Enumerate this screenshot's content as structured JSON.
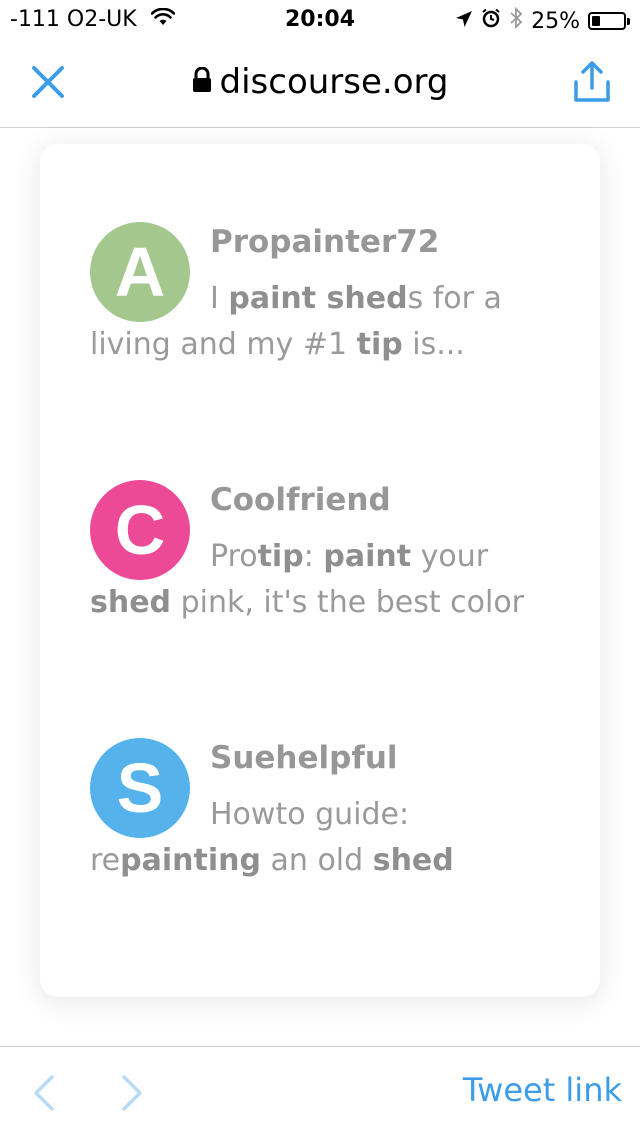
{
  "status_bar": {
    "carrier": "-111 O2-UK",
    "time": "20:04",
    "battery_percent": "25%",
    "battery_level": 0.25
  },
  "nav": {
    "domain": "discourse.org"
  },
  "results": [
    {
      "avatar_letter": "A",
      "avatar_color": "#a3c78d",
      "username": "Propainter72",
      "title_parts": [
        {
          "t": "I ",
          "b": false
        },
        {
          "t": "paint shed",
          "b": true
        },
        {
          "t": "s for a living and my #1 ",
          "b": false
        },
        {
          "t": "tip",
          "b": true
        },
        {
          "t": " is...",
          "b": false
        }
      ]
    },
    {
      "avatar_letter": "C",
      "avatar_color": "#ec4a96",
      "username": "Coolfriend",
      "title_parts": [
        {
          "t": "Pro",
          "b": false
        },
        {
          "t": "tip",
          "b": true
        },
        {
          "t": ": ",
          "b": false
        },
        {
          "t": "paint",
          "b": true
        },
        {
          "t": " your ",
          "b": false
        },
        {
          "t": "shed",
          "b": true
        },
        {
          "t": " pink, it's the best color",
          "b": false
        }
      ]
    },
    {
      "avatar_letter": "S",
      "avatar_color": "#56b2ea",
      "username": "Suehelpful",
      "title_parts": [
        {
          "t": "Howto guide: re",
          "b": false
        },
        {
          "t": "painting",
          "b": true
        },
        {
          "t": " an old ",
          "b": false
        },
        {
          "t": "shed",
          "b": true
        }
      ]
    }
  ],
  "toolbar": {
    "tweet_link_label": "Tweet link"
  },
  "colors": {
    "accent": "#3d9ce8",
    "nav_disabled": "#b9daf5"
  }
}
